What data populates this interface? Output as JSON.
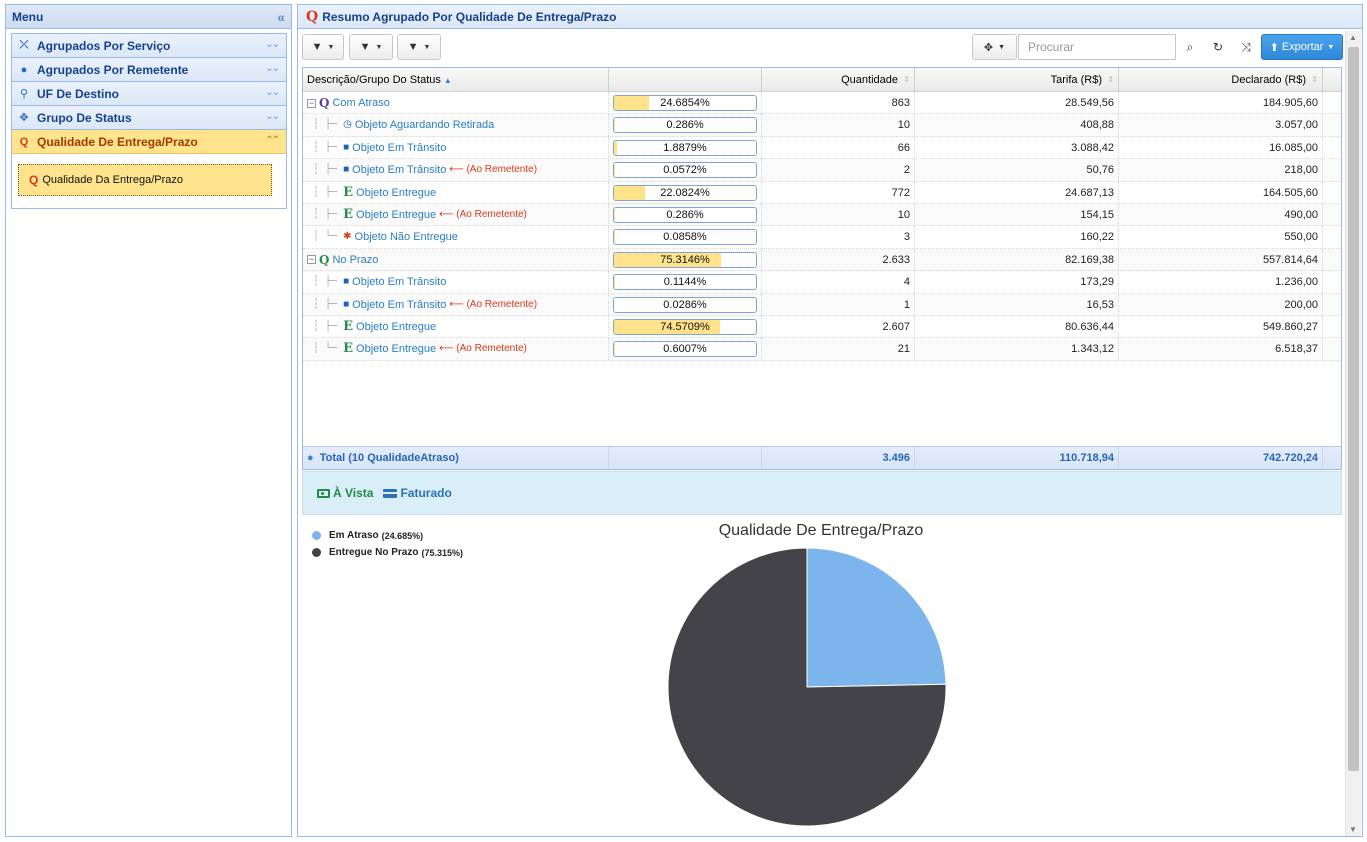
{
  "menu": {
    "title": "Menu",
    "items": [
      {
        "label": "Agrupados Por Serviço",
        "icon": "route-icon"
      },
      {
        "label": "Agrupados Por Remetente",
        "icon": "user-icon"
      },
      {
        "label": "UF De Destino",
        "icon": "map-pin-icon"
      },
      {
        "label": "Grupo De Status",
        "icon": "move-icon"
      },
      {
        "label": "Qualidade De Entrega/Prazo",
        "icon": "quality-icon",
        "active": true
      }
    ],
    "sub_item": "Qualidade Da Entrega/Prazo"
  },
  "main": {
    "title": "Resumo Agrupado Por Qualidade De Entrega/Prazo",
    "search_placeholder": "Procurar",
    "export_label": "Exportar"
  },
  "grid": {
    "columns": [
      "Descrição/Grupo Do Status",
      "",
      "Quantidade",
      "Tarifa (R$)",
      "Declarado (R$)"
    ],
    "rows": [
      {
        "level": 0,
        "label": "Com Atraso",
        "icon": "quality-late-icon",
        "pct": "24.6854%",
        "fraction": 0.246854,
        "qty": "863",
        "tarifa": "28.549,56",
        "declarado": "184.905,60"
      },
      {
        "level": 1,
        "label": "Objeto Aguardando Retirada",
        "icon": "clock-icon",
        "pct": "0.286%",
        "fraction": 0.00286,
        "qty": "10",
        "tarifa": "408,88",
        "declarado": "3.057,00"
      },
      {
        "level": 1,
        "label": "Objeto Em Trânsito",
        "icon": "truck-icon",
        "pct": "1.8879%",
        "fraction": 0.018879,
        "qty": "66",
        "tarifa": "3.088,42",
        "declarado": "16.085,00"
      },
      {
        "level": 1,
        "label": "Objeto Em Trânsito",
        "icon": "truck-icon",
        "ret": "(Ao Remetente)",
        "pct": "0.0572%",
        "fraction": 0.000572,
        "qty": "2",
        "tarifa": "50,76",
        "declarado": "218,00"
      },
      {
        "level": 1,
        "label": "Objeto Entregue",
        "icon": "delivered-icon",
        "pct": "22.0824%",
        "fraction": 0.220824,
        "qty": "772",
        "tarifa": "24.687,13",
        "declarado": "164.505,60"
      },
      {
        "level": 1,
        "label": "Objeto Entregue",
        "icon": "delivered-icon",
        "ret": "(Ao Remetente)",
        "pct": "0.286%",
        "fraction": 0.00286,
        "qty": "10",
        "tarifa": "154,15",
        "declarado": "490,00"
      },
      {
        "level": 1,
        "label": "Objeto Não Entregue",
        "icon": "bug-icon",
        "pct": "0.0858%",
        "fraction": 0.000858,
        "qty": "3",
        "tarifa": "160,22",
        "declarado": "550,00",
        "last": true
      },
      {
        "level": 0,
        "label": "No Prazo",
        "icon": "quality-ok-icon",
        "pct": "75.3146%",
        "fraction": 0.753146,
        "qty": "2.633",
        "tarifa": "82.169,38",
        "declarado": "557.814,64"
      },
      {
        "level": 1,
        "label": "Objeto Em Trânsito",
        "icon": "truck-icon",
        "pct": "0.1144%",
        "fraction": 0.001144,
        "qty": "4",
        "tarifa": "173,29",
        "declarado": "1.236,00"
      },
      {
        "level": 1,
        "label": "Objeto Em Trânsito",
        "icon": "truck-icon",
        "ret": "(Ao Remetente)",
        "pct": "0.0286%",
        "fraction": 0.000286,
        "qty": "1",
        "tarifa": "16,53",
        "declarado": "200,00"
      },
      {
        "level": 1,
        "label": "Objeto Entregue",
        "icon": "delivered-icon",
        "pct": "74.5709%",
        "fraction": 0.745709,
        "qty": "2.607",
        "tarifa": "80.636,44",
        "declarado": "549.860,27"
      },
      {
        "level": 1,
        "label": "Objeto Entregue",
        "icon": "delivered-icon",
        "ret": "(Ao Remetente)",
        "pct": "0.6007%",
        "fraction": 0.006007,
        "qty": "21",
        "tarifa": "1.343,12",
        "declarado": "6.518,37",
        "last": true
      }
    ],
    "total": {
      "label": "Total (10 QualidadeAtraso)",
      "qty": "3.496",
      "tarifa": "110.718,94",
      "declarado": "742.720,24"
    }
  },
  "payment": {
    "vista": "À Vista",
    "faturado": "Faturado"
  },
  "chart_data": {
    "type": "pie",
    "title": "Qualidade De Entrega/Prazo",
    "series": [
      {
        "name": "Em Atraso",
        "label_pct": "(24.685%)",
        "value": 24.685,
        "color": "#7cb5ec"
      },
      {
        "name": "Entregue No Prazo",
        "label_pct": "(75.315%)",
        "value": 75.315,
        "color": "#434348"
      }
    ],
    "legend": "top-left"
  }
}
